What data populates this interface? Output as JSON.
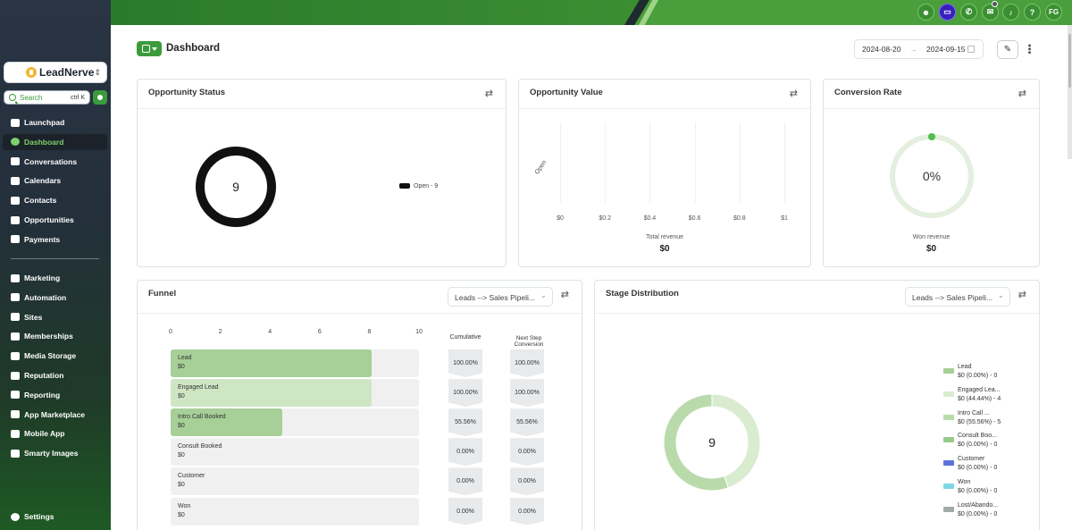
{
  "sidebar": {
    "brand": "LeadNerve",
    "search": {
      "placeholder": "Search",
      "shortcut": "ctrl K"
    },
    "nav_primary": [
      {
        "label": "Launchpad",
        "icon": "rocket-icon",
        "active": false
      },
      {
        "label": "Dashboard",
        "icon": "dashboard-icon",
        "active": true
      },
      {
        "label": "Conversations",
        "icon": "chat-icon",
        "active": false
      },
      {
        "label": "Calendars",
        "icon": "calendar-icon",
        "active": false
      },
      {
        "label": "Contacts",
        "icon": "contacts-icon",
        "active": false
      },
      {
        "label": "Opportunities",
        "icon": "opportunities-icon",
        "active": false
      },
      {
        "label": "Payments",
        "icon": "payments-icon",
        "active": false
      }
    ],
    "nav_secondary": [
      {
        "label": "Marketing",
        "icon": "marketing-icon"
      },
      {
        "label": "Automation",
        "icon": "automation-icon"
      },
      {
        "label": "Sites",
        "icon": "sites-icon"
      },
      {
        "label": "Memberships",
        "icon": "memberships-icon"
      },
      {
        "label": "Media Storage",
        "icon": "media-icon"
      },
      {
        "label": "Reputation",
        "icon": "reputation-icon"
      },
      {
        "label": "Reporting",
        "icon": "reporting-icon"
      },
      {
        "label": "App Marketplace",
        "icon": "marketplace-icon"
      },
      {
        "label": "Mobile App",
        "icon": "mobile-icon"
      },
      {
        "label": "Smarty Images",
        "icon": "images-icon"
      }
    ],
    "settings_label": "Settings"
  },
  "topbar": {
    "icons": [
      "robot-icon",
      "message-icon",
      "phone-icon",
      "megaphone-icon",
      "bell-icon",
      "help-icon"
    ],
    "help_glyph": "?",
    "avatar_initials": "FG"
  },
  "header": {
    "title": "Dashboard",
    "date_start": "2024-08-20",
    "date_end": "2024-09-15"
  },
  "opportunity_status": {
    "title": "Opportunity Status",
    "total": "9",
    "legend": "Open - 9"
  },
  "opportunity_value": {
    "title": "Opportunity Value",
    "y_label": "Open",
    "x_ticks": [
      "$0",
      "$0.2",
      "$0.4",
      "$0.6",
      "$0.8",
      "$1"
    ],
    "footer_label": "Total revenue",
    "footer_value": "$0"
  },
  "conversion_rate": {
    "title": "Conversion Rate",
    "value": "0%",
    "footer_label": "Won revenue",
    "footer_value": "$0"
  },
  "funnel": {
    "title": "Funnel",
    "pipeline": "Leads --> Sales Pipeli...",
    "axis_ticks": [
      "0",
      "2",
      "4",
      "6",
      "8",
      "10"
    ],
    "col_cumulative": "Cumulative",
    "col_next_step_1": "Next Step",
    "col_next_step_2": "Conversion",
    "axis_max": 10,
    "rows": [
      {
        "name": "Lead",
        "value": "$0",
        "count": 9,
        "color": "#a7cf98",
        "cumulative": "100.00%",
        "next": "100.00%"
      },
      {
        "name": "Engaged Lead",
        "value": "$0",
        "count": 9,
        "color": "#cfe6c4",
        "cumulative": "100.00%",
        "next": "100.00%"
      },
      {
        "name": "Intro Call Booked",
        "value": "$0",
        "count": 5,
        "color": "#a7cf98",
        "cumulative": "55.56%",
        "next": "55.56%"
      },
      {
        "name": "Consult Booked",
        "value": "$0",
        "count": 0,
        "color": "#a7cf98",
        "cumulative": "0.00%",
        "next": "0.00%"
      },
      {
        "name": "Customer",
        "value": "$0",
        "count": 0,
        "color": "#a7cf98",
        "cumulative": "0.00%",
        "next": "0.00%"
      },
      {
        "name": "Won",
        "value": "$0",
        "count": 0,
        "color": "#a7cf98",
        "cumulative": "0.00%",
        "next": "0.00%"
      }
    ]
  },
  "stage_distribution": {
    "title": "Stage Distribution",
    "pipeline": "Leads --> Sales Pipeli...",
    "total": "9",
    "legend": [
      {
        "name": "Lead",
        "detail": "$0 (0.00%) - 0",
        "color": "#a7cf98"
      },
      {
        "name": "Engaged Lea...",
        "detail": "$0 (44.44%) - 4",
        "color": "#d9ecd0"
      },
      {
        "name": "Intro Call ...",
        "detail": "$0 (55.56%) - 5",
        "color": "#b9dbab"
      },
      {
        "name": "Consult Boo...",
        "detail": "$0 (0.00%) - 0",
        "color": "#98c98a"
      },
      {
        "name": "Customer",
        "detail": "$0 (0.00%) - 0",
        "color": "#5b73d9"
      },
      {
        "name": "Won",
        "detail": "$0 (0.00%) - 0",
        "color": "#7fd6e9"
      },
      {
        "name": "Lost/Abando...",
        "detail": "$0 (0.00%) - 0",
        "color": "#a2aaa6"
      }
    ],
    "slices": [
      {
        "value": 4,
        "color": "#d9ecd0"
      },
      {
        "value": 5,
        "color": "#b9dbab"
      }
    ]
  },
  "colors": {
    "brand_green": "#3b9b3b",
    "topbar_green": "#4a9e3c"
  }
}
